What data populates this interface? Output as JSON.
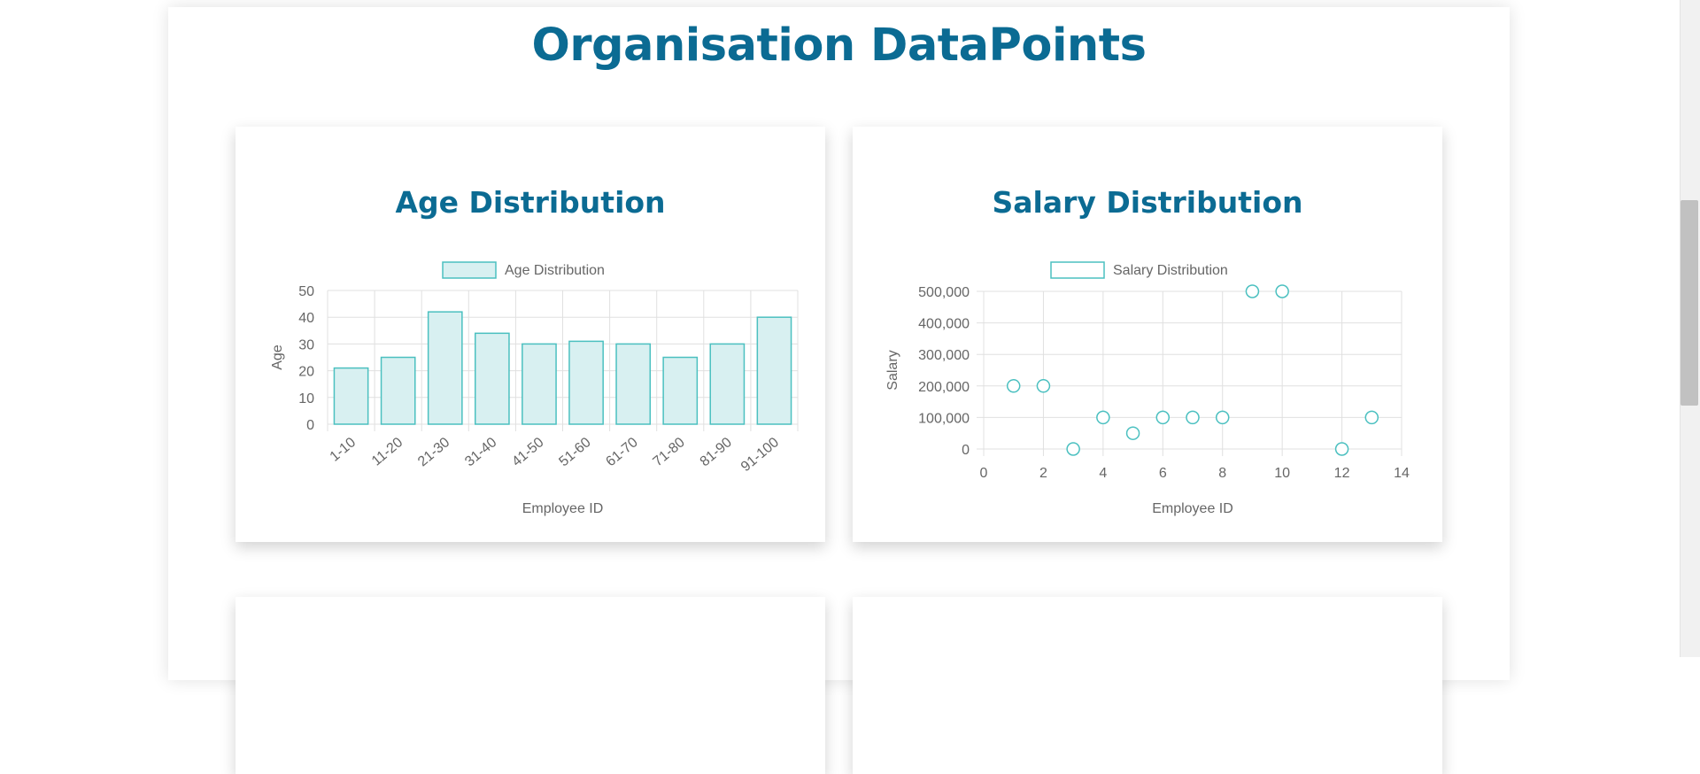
{
  "page": {
    "title": "Organisation DataPoints"
  },
  "colors": {
    "title": "#0b6b93",
    "series_stroke": "#4bc0c0",
    "series_fill": "#d8f0f1",
    "grid": "#e0e0e0",
    "text": "#666666"
  },
  "chart_data": [
    {
      "type": "bar",
      "title": "Age Distribution",
      "legend": "Age Distribution",
      "legend_position": "top",
      "grid": true,
      "xlabel": "Employee ID",
      "ylabel": "Age",
      "categories": [
        "1-10",
        "11-20",
        "21-30",
        "31-40",
        "41-50",
        "51-60",
        "61-70",
        "71-80",
        "81-90",
        "91-100"
      ],
      "values": [
        21,
        25,
        42,
        34,
        30,
        31,
        30,
        25,
        30,
        40
      ],
      "ylim": [
        0,
        50
      ],
      "yticks": [
        0,
        10,
        20,
        30,
        40,
        50
      ]
    },
    {
      "type": "scatter",
      "title": "Salary Distribution",
      "legend": "Salary Distribution",
      "legend_position": "top",
      "grid": true,
      "xlabel": "Employee ID",
      "ylabel": "Salary",
      "x": [
        1,
        2,
        3,
        4,
        5,
        6,
        7,
        8,
        9,
        10,
        12,
        13
      ],
      "y": [
        200000,
        200000,
        0,
        100000,
        50000,
        100000,
        100000,
        100000,
        500000,
        500000,
        0,
        100000
      ],
      "xlim": [
        0,
        14
      ],
      "ylim": [
        0,
        500000
      ],
      "xticks": [
        0,
        2,
        4,
        6,
        8,
        10,
        12,
        14
      ],
      "yticks": [
        "0",
        "100,000",
        "200,000",
        "300,000",
        "400,000",
        "500,000"
      ]
    }
  ]
}
